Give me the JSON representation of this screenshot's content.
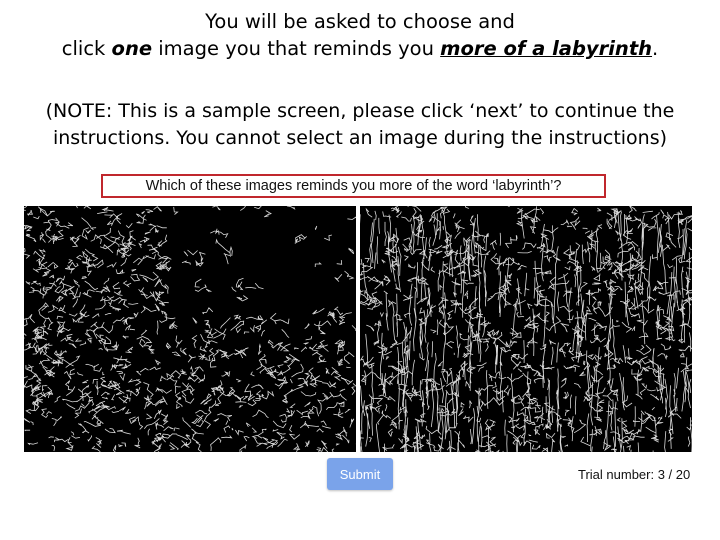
{
  "heading": {
    "line1": "You will be asked to choose and",
    "line2_pre": "click ",
    "line2_one": "one",
    "line2_mid": " image you that reminds you ",
    "line2_emph": "more of a labyrinth",
    "line2_post": "."
  },
  "note": {
    "line1": "(NOTE: This is a sample screen, please click ‘next’ to continue the",
    "line2": "instructions. You cannot select an image during the instructions)"
  },
  "question": "Which of these images reminds you more of the word ‘labyrinth’?",
  "images": [
    {
      "id": "left",
      "style": "black background with white edge-detected line drawing"
    },
    {
      "id": "right",
      "style": "black background with white edge-detected line drawing"
    }
  ],
  "submit_label": "Submit",
  "trial": {
    "label": "Trial number:",
    "current": "3",
    "total": "20",
    "text": "Trial number: 3 / 20"
  },
  "colors": {
    "box_border": "#c0272d",
    "button": "#7aa3ea",
    "image_bg": "#000000"
  }
}
